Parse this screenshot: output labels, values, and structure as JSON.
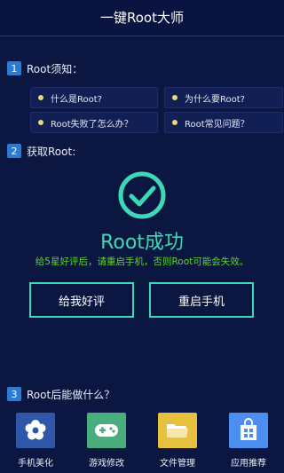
{
  "header": {
    "title": "一键Root大师"
  },
  "sections": [
    {
      "num": "1",
      "title": "Root须知："
    },
    {
      "num": "2",
      "title": "获取Root:"
    },
    {
      "num": "3",
      "title": "Root后能做什么？"
    }
  ],
  "faq": [
    {
      "label": "什么是Root?"
    },
    {
      "label": "为什么要Root?"
    },
    {
      "label": "Root失败了怎么办？"
    },
    {
      "label": "Root常见问题？"
    }
  ],
  "result": {
    "status": "Root成功",
    "message": "给5星好评后，请重启手机，否则Root可能会失效。"
  },
  "buttons": {
    "rate": "给我好评",
    "reboot": "重启手机"
  },
  "apps": [
    {
      "label": "手机美化",
      "icon": "flower-icon",
      "color": "#2e57a9"
    },
    {
      "label": "游戏修改",
      "icon": "gamepad-icon",
      "color": "#49ad7e"
    },
    {
      "label": "文件管理",
      "icon": "folder-icon",
      "color": "#e6c13e"
    },
    {
      "label": "应用推荐",
      "icon": "app-store-icon",
      "color": "#4d8ff0"
    }
  ],
  "colors": {
    "accent": "#3ed8b8",
    "warning": "#5fd32f",
    "background": "#0c1741"
  }
}
